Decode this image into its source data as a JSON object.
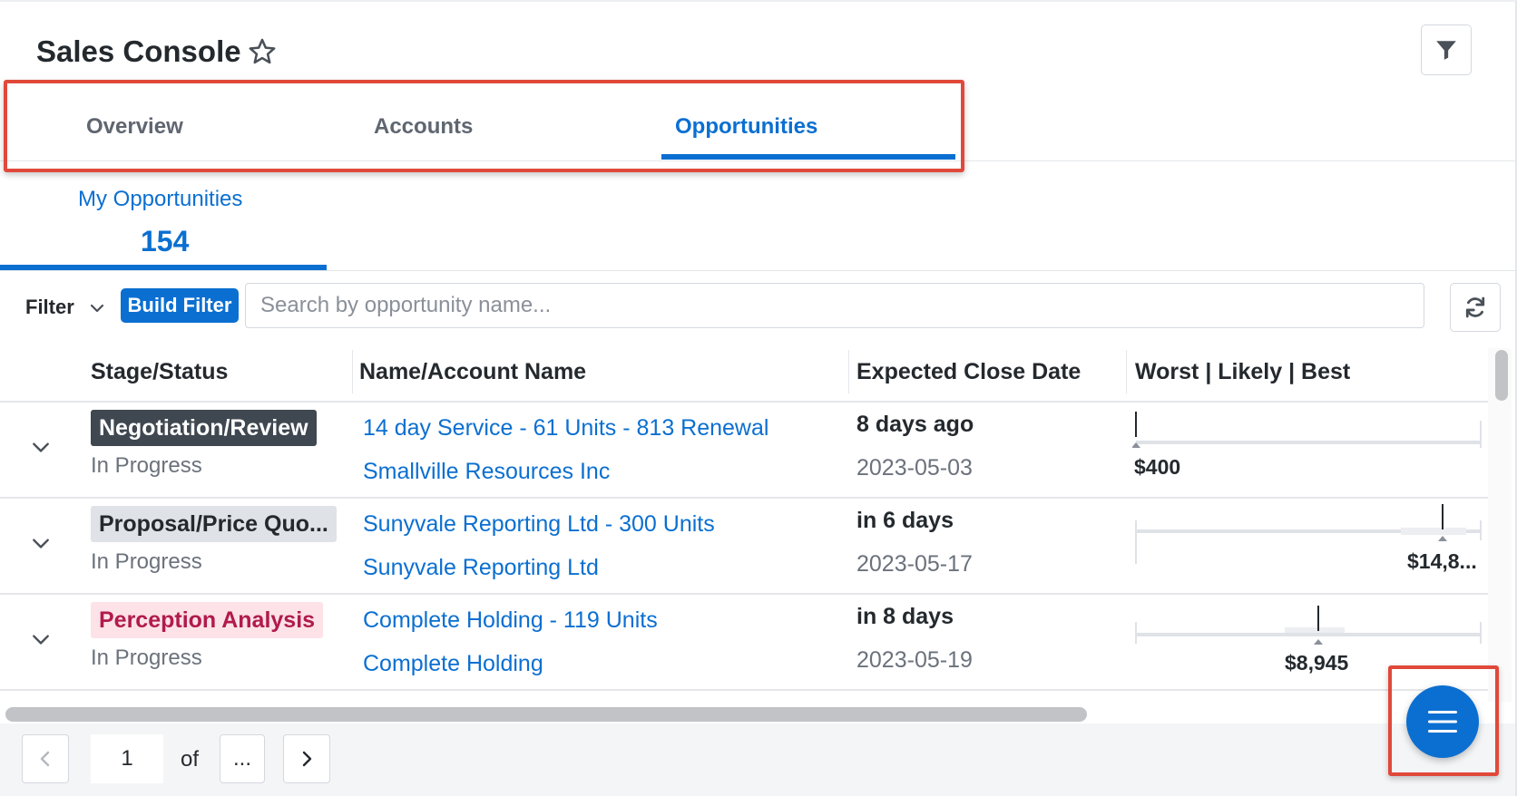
{
  "header": {
    "title": "Sales Console",
    "favorite_icon": "star-icon",
    "filter_icon": "funnel-icon"
  },
  "tabs": [
    {
      "label": "Overview",
      "active": false
    },
    {
      "label": "Accounts",
      "active": false
    },
    {
      "label": "Opportunities",
      "active": true
    }
  ],
  "dashlet": {
    "label": "My Opportunities",
    "count": "154"
  },
  "filter_bar": {
    "filter_label": "Filter",
    "build_filter_label": "Build Filter",
    "search_placeholder": "Search by opportunity name...",
    "refresh_icon": "refresh-icon"
  },
  "table": {
    "columns": [
      "Stage/Status",
      "Name/Account Name",
      "Expected Close Date",
      "Worst | Likely | Best"
    ],
    "rows": [
      {
        "stage": "Negotiation/Review",
        "stage_style": "dark",
        "status": "In Progress",
        "name": "14 day Service - 61 Units - 813 Renewal",
        "account": "Smallville Resources Inc",
        "relative_date": "8 days ago",
        "date": "2023-05-03",
        "forecast_value": "$400"
      },
      {
        "stage": "Proposal/Price Quo...",
        "stage_style": "light",
        "status": "In Progress",
        "name": "Sunyvale Reporting Ltd - 300 Units",
        "account": "Sunyvale Reporting Ltd",
        "relative_date": "in 6 days",
        "date": "2023-05-17",
        "forecast_value": "$14,8..."
      },
      {
        "stage": "Perception Analysis",
        "stage_style": "pink",
        "status": "In Progress",
        "name": "Complete Holding - 119 Units",
        "account": "Complete Holding",
        "relative_date": "in 8 days",
        "date": "2023-05-19",
        "forecast_value": "$8,945"
      }
    ]
  },
  "pagination": {
    "current_page": "1",
    "of_label": "of",
    "total_pages": "..."
  },
  "colors": {
    "accent": "#0b6fd1",
    "highlight": "#e0493a"
  }
}
